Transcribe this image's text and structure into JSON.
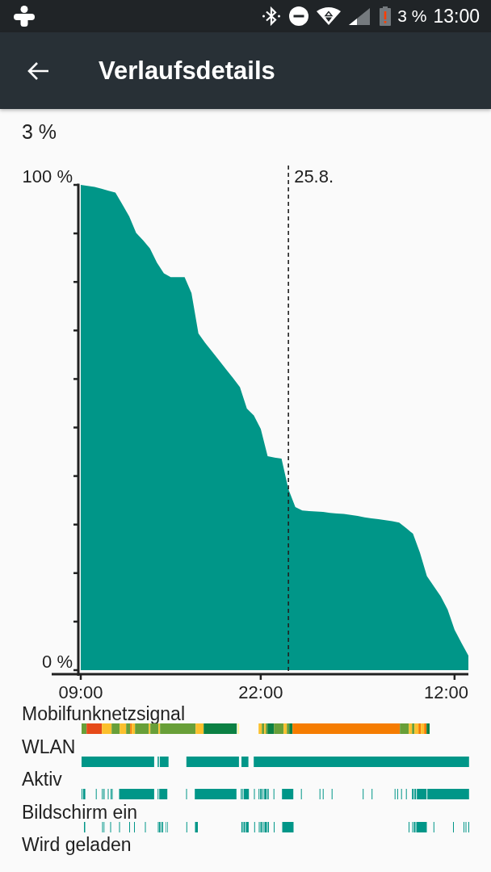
{
  "status_bar": {
    "battery_text": "3 %",
    "time": "13:00"
  },
  "app_bar": {
    "title": "Verlaufsdetails"
  },
  "battery_level": "3 %",
  "chart": {
    "chart_data": {
      "type": "area",
      "categories": [
        "09:00",
        null,
        null,
        null,
        null,
        null,
        null,
        null,
        null,
        null,
        null,
        null,
        null,
        null,
        null,
        null,
        null,
        null,
        null,
        null,
        null,
        null,
        null,
        null,
        null,
        null,
        "22:00",
        null,
        null,
        null,
        null,
        null,
        null,
        null,
        null,
        null,
        null,
        null,
        null,
        null,
        null,
        null,
        null,
        null,
        null,
        null,
        null,
        null,
        null,
        null,
        null,
        null,
        null,
        null,
        "12:00",
        null,
        null
      ],
      "series": [
        {
          "color": "#009688",
          "values": [
            100,
            99.8,
            99.6,
            99.2,
            98.8,
            98.4,
            96.0,
            93.5,
            90.1,
            88.6,
            86.9,
            84.0,
            81.8,
            81,
            81,
            81,
            77.7,
            69.4,
            67.4,
            65.6,
            63.8,
            62.0,
            60.2,
            58.3,
            53.9,
            52.5,
            49.7,
            44.1,
            43.8,
            43.6,
            37.3,
            33.6,
            32.9,
            32.8,
            32.7,
            32.6,
            32.4,
            32.3,
            32.2,
            32.0,
            31.8,
            31.5,
            31.3,
            31.1,
            30.9,
            30.7,
            30.4,
            29.3,
            28.1,
            24.2,
            19.4,
            17.3,
            15.2,
            12.5,
            8.3,
            5.6,
            3
          ]
        }
      ],
      "ylim": [
        0,
        100
      ],
      "yticks": [
        {
          "value": 0,
          "label": "0 %"
        },
        {
          "value": 100,
          "label": "100 %"
        }
      ],
      "annotations": [
        "25.8."
      ]
    }
  },
  "timelines": [
    {
      "label": "Mobilfunknetzsignal"
    },
    {
      "label": "WLAN"
    },
    {
      "label": "Aktiv"
    },
    {
      "label": "Bildschirm ein"
    },
    {
      "label": "Wird geladen"
    }
  ]
}
